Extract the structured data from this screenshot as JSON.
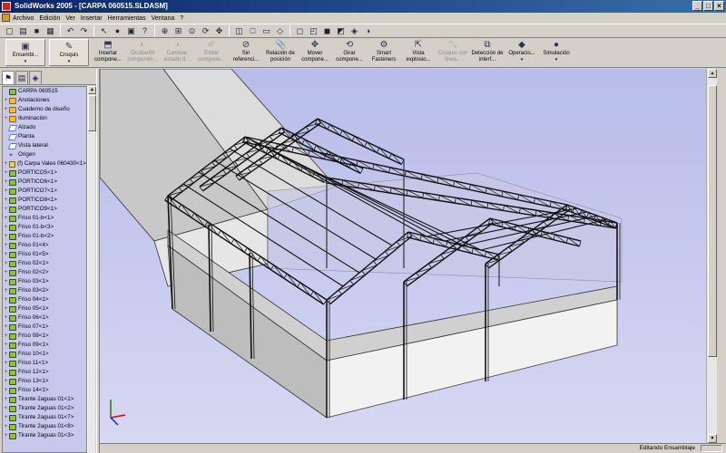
{
  "window": {
    "title": "SolidWorks 2005 - [CARPA 060515.SLDASM]",
    "controls": [
      "_",
      "□",
      "×"
    ]
  },
  "menu": [
    "Archivo",
    "Edición",
    "Ver",
    "Insertar",
    "Herramientas",
    "Ventana",
    "?"
  ],
  "toolbar_icons": [
    "new-icon",
    "open-icon",
    "save-icon",
    "print-icon",
    "undo-icon",
    "redo-icon",
    "select-icon",
    "rebuild-icon",
    "zoom-icon",
    "rotate-icon",
    "pan-icon",
    "view-orientation-icon",
    "display-style-icon"
  ],
  "command_manager": [
    {
      "label": "Ensambl...",
      "icon": "assembly-icon",
      "disabled": false,
      "dropdown": true
    },
    {
      "label": "Croquis",
      "icon": "sketch-icon",
      "disabled": false,
      "dropdown": true
    },
    {
      "label": "Insertar compone...",
      "icon": "insert-component-icon",
      "disabled": false
    },
    {
      "label": "Ocultar/M componen...",
      "icon": "hide-show-icon",
      "disabled": true
    },
    {
      "label": "Cambiar estado d...",
      "icon": "change-state-icon",
      "disabled": true
    },
    {
      "label": "Editar compone...",
      "icon": "edit-component-icon",
      "disabled": true
    },
    {
      "label": "Sin referenci...",
      "icon": "no-external-references-icon",
      "disabled": false
    },
    {
      "label": "Relación de posición",
      "icon": "mate-icon",
      "disabled": false
    },
    {
      "label": "Mover compone...",
      "icon": "move-component-icon",
      "disabled": false
    },
    {
      "label": "Girar compone...",
      "icon": "rotate-component-icon",
      "disabled": false
    },
    {
      "label": "Smart Fasteners",
      "icon": "smart-fasteners-icon",
      "disabled": false
    },
    {
      "label": "Vista explosio...",
      "icon": "exploded-view-icon",
      "disabled": false
    },
    {
      "label": "Croquis con línea...",
      "icon": "explode-line-sketch-icon",
      "disabled": true
    },
    {
      "label": "Detección de interf...",
      "icon": "interference-detection-icon",
      "disabled": false
    },
    {
      "label": "Operacio...",
      "icon": "features-icon",
      "disabled": false,
      "dropdown": true
    },
    {
      "label": "Simulación",
      "icon": "simulation-icon",
      "disabled": false,
      "dropdown": true
    }
  ],
  "tree": [
    {
      "label": "CARPA 060515",
      "type": "asm",
      "expand": ""
    },
    {
      "label": "Anotaciones",
      "type": "folder",
      "expand": "+"
    },
    {
      "label": "Cuaderno de diseño",
      "type": "folder",
      "expand": "+"
    },
    {
      "label": "Iluminación",
      "type": "folder",
      "expand": "+"
    },
    {
      "label": "Alzado",
      "type": "plane",
      "expand": ""
    },
    {
      "label": "Planta",
      "type": "plane",
      "expand": ""
    },
    {
      "label": "Vista lateral",
      "type": "plane",
      "expand": ""
    },
    {
      "label": "Origen",
      "type": "origin",
      "expand": ""
    },
    {
      "label": "(f) Carpa Valeo 060430<1>",
      "type": "part",
      "expand": "+"
    },
    {
      "label": "PORTICO5<1>",
      "type": "asm",
      "expand": "+"
    },
    {
      "label": "PORTICO6<1>",
      "type": "asm",
      "expand": "+"
    },
    {
      "label": "PORTICO7<1>",
      "type": "asm",
      "expand": "+"
    },
    {
      "label": "PORTICO8<1>",
      "type": "asm",
      "expand": "+"
    },
    {
      "label": "PORTICO9<1>",
      "type": "asm",
      "expand": "+"
    },
    {
      "label": "Friso 01-b<1>",
      "type": "asm",
      "expand": "+"
    },
    {
      "label": "Friso 01-b<3>",
      "type": "asm",
      "expand": "+"
    },
    {
      "label": "Friso 01-b<2>",
      "type": "asm",
      "expand": "+"
    },
    {
      "label": "Friso 01<4>",
      "type": "asm",
      "expand": "+"
    },
    {
      "label": "Friso 01<5>",
      "type": "asm",
      "expand": "+"
    },
    {
      "label": "Friso 02<1>",
      "type": "asm",
      "expand": "+"
    },
    {
      "label": "Friso 02<2>",
      "type": "asm",
      "expand": "+"
    },
    {
      "label": "Friso 03<1>",
      "type": "asm",
      "expand": "+"
    },
    {
      "label": "Friso 03<2>",
      "type": "asm",
      "expand": "+"
    },
    {
      "label": "Friso 04<1>",
      "type": "asm",
      "expand": "+"
    },
    {
      "label": "Friso 05<1>",
      "type": "asm",
      "expand": "+"
    },
    {
      "label": "Friso 06<1>",
      "type": "asm",
      "expand": "+"
    },
    {
      "label": "Friso 07<1>",
      "type": "asm",
      "expand": "+"
    },
    {
      "label": "Friso 08<1>",
      "type": "asm",
      "expand": "+"
    },
    {
      "label": "Friso 09<1>",
      "type": "asm",
      "expand": "+"
    },
    {
      "label": "Friso 10<1>",
      "type": "asm",
      "expand": "+"
    },
    {
      "label": "Friso 11<1>",
      "type": "asm",
      "expand": "+"
    },
    {
      "label": "Friso 12<1>",
      "type": "asm",
      "expand": "+"
    },
    {
      "label": "Friso 13<1>",
      "type": "asm",
      "expand": "+"
    },
    {
      "label": "Friso 14<1>",
      "type": "asm",
      "expand": "+"
    },
    {
      "label": "Tirante 2aguas 01<1>",
      "type": "asm",
      "expand": "+"
    },
    {
      "label": "Tirante 2aguas 01<2>",
      "type": "asm",
      "expand": "+"
    },
    {
      "label": "Tirante 2aguas 01<7>",
      "type": "asm",
      "expand": "+"
    },
    {
      "label": "Tirante 2aguas 01<8>",
      "type": "asm",
      "expand": "+"
    },
    {
      "label": "Tirante 2aguas 01<3>",
      "type": "asm",
      "expand": "+"
    }
  ],
  "tabs": [
    "feature-manager-icon",
    "property-manager-icon",
    "configuration-manager-icon"
  ],
  "status": {
    "text": "Editando Ensamblaje"
  },
  "colors": {
    "viewport_top": "#b8bde8",
    "viewport_bottom": "#d7d8f2",
    "tree_bg": "#c8c8ec",
    "title_start": "#0a246a",
    "title_end": "#3a6ea5"
  }
}
